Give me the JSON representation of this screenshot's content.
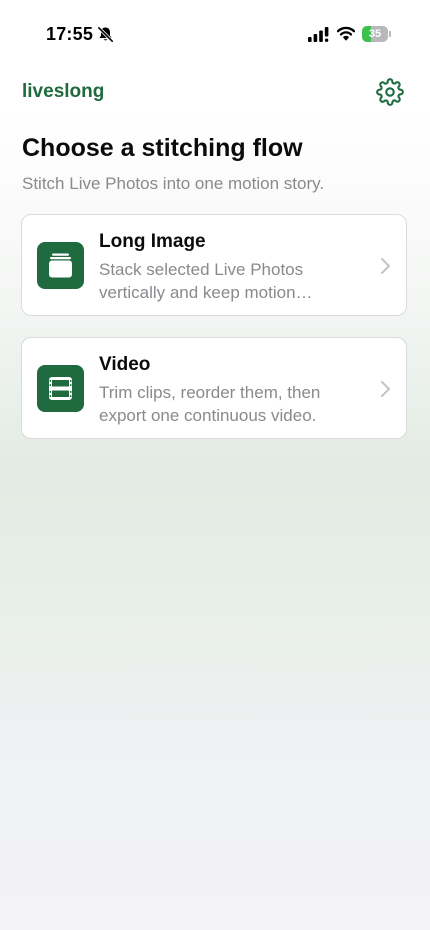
{
  "status_bar": {
    "time": "17:55",
    "battery_level": "35",
    "battery_fraction": 0.35,
    "icons": [
      "bell-off-icon",
      "signal-icon",
      "wifi-icon",
      "battery-icon"
    ]
  },
  "header": {
    "app_name": "liveslong",
    "settings_icon": "gear-icon"
  },
  "main": {
    "title": "Choose a stitching flow",
    "subtitle": "Stitch Live Photos into one motion story."
  },
  "flows": [
    {
      "title": "Long Image",
      "description": "Stack selected Live Photos vertically and keep motion…",
      "icon": "stacked-photos-icon"
    },
    {
      "title": "Video",
      "description": "Trim clips, reorder them, then export one continuous video.",
      "icon": "film-strip-icon"
    }
  ],
  "colors": {
    "accent": "#1f6b3f",
    "secondary_text": "#8a8a8e",
    "battery_fill": "#3cc14f"
  }
}
